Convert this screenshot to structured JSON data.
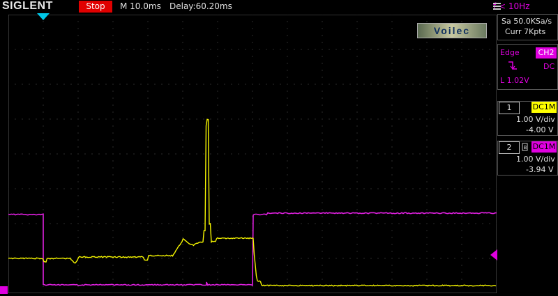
{
  "header": {
    "brand": "SIGLENT",
    "run_state": "Stop",
    "timebase": "M 10.0ms",
    "delay": "Delay:60.20ms",
    "frequency": "f < 10Hz"
  },
  "acquisition": {
    "sample_rate": "Sa 50.0KSa/s",
    "memory": "Curr 7Kpts"
  },
  "trigger": {
    "type": "Edge",
    "source": "CH2",
    "coupling": "DC",
    "slope_icon": "falling-edge-icon",
    "level": "L  1.02V"
  },
  "channels": [
    {
      "number": "1",
      "coupling": "DC1M",
      "scale": "1.00 V/div",
      "offset": "-4.00 V",
      "color": "#ffff00"
    },
    {
      "number": "2",
      "coupling": "DC1M",
      "scale": "1.00 V/div",
      "offset": "-3.94 V",
      "color": "#e000e0"
    }
  ],
  "watermark": "Voilec",
  "colors": {
    "ch1": "#f5f500",
    "ch2": "#e020e0",
    "stop_bg": "#e00000",
    "grid": "#555555"
  }
}
